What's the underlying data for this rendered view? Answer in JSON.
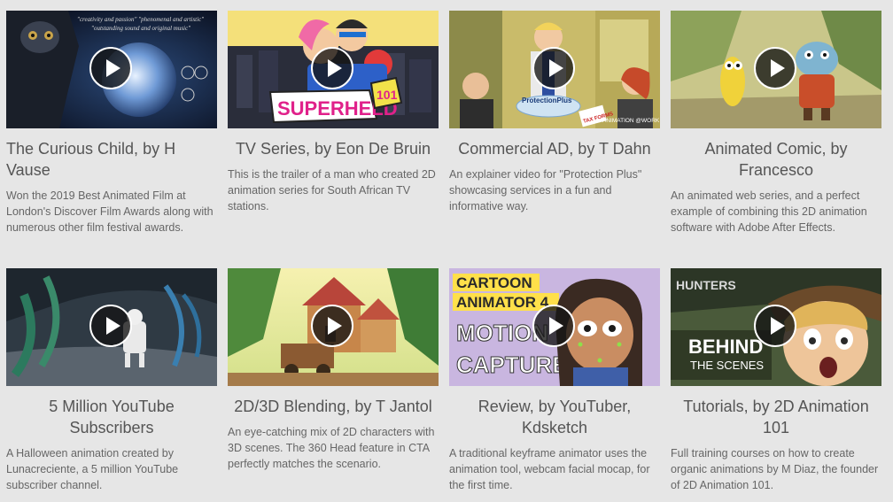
{
  "cards": [
    {
      "title": "The Curious Child, by H Vause",
      "description": "Won the 2019 Best Animated Film at London's Discover Film Awards along with numerous other film festival awards.",
      "thumbnail_text": [
        "\"creativity and passion\"  \"phenomenal and artistic\"",
        "\"outstanding sound and original music\""
      ]
    },
    {
      "title": "TV Series, by Eon De Bruin",
      "description": "This is the trailer of a man who created 2D animation series for South African TV stations.",
      "thumbnail_text": [
        "SUPERHELD",
        "101"
      ]
    },
    {
      "title": "Commercial AD, by T Dahn",
      "description": "An explainer video for \"Protection Plus\" showcasing services in a fun and informative way.",
      "thumbnail_text": [
        "ProtectionPlus",
        "ANIMATION @WORK",
        "TAX FORMS"
      ]
    },
    {
      "title": "Animated Comic, by Francesco",
      "description": "An animated web series, and a perfect example of combining this 2D animation software with Adobe After Effects.",
      "thumbnail_text": []
    },
    {
      "title": "5 Million YouTube Subscribers",
      "description": "A Halloween animation created by Lunacreciente, a 5 million YouTube subscriber channel.",
      "thumbnail_text": []
    },
    {
      "title": "2D/3D Blending, by T Jantol",
      "description": "An eye-catching mix of 2D characters with 3D scenes. The 360 Head feature in CTA perfectly matches the scenario.",
      "thumbnail_text": []
    },
    {
      "title": "Review, by YouTuber, Kdsketch",
      "description": "A traditional keyframe animator uses the animation tool, webcam facial mocap, for the first time.",
      "thumbnail_text": [
        "CARTOON",
        "ANIMATOR 4",
        "MOTION",
        "CAPTURE"
      ]
    },
    {
      "title": "Tutorials, by 2D Animation 101",
      "description": "Full training courses on how to create organic animations by M Diaz, the founder of 2D Animation 101.",
      "thumbnail_text": [
        "HUNTERS",
        "BEHIND",
        "THE SCENES"
      ]
    }
  ],
  "icons": {
    "play": "play-icon"
  },
  "colors": {
    "background": "#e6e6e6",
    "title": "#555555",
    "description": "#666666",
    "play_bg": "#1a1a1a"
  }
}
